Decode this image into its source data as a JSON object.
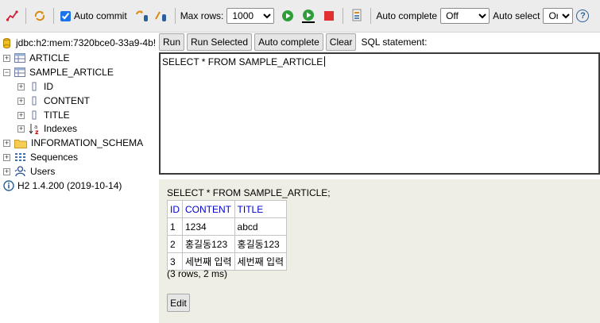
{
  "toolbar": {
    "auto_commit_label": "Auto commit",
    "auto_commit_checked": true,
    "max_rows_label": "Max rows:",
    "max_rows_value": "1000",
    "auto_complete_label": "Auto complete",
    "auto_complete_value": "Off",
    "auto_select_label": "Auto select",
    "auto_select_value": "On",
    "help_glyph": "?"
  },
  "tree": {
    "connection": "jdbc:h2:mem:7320bce0-33a9-4b!",
    "items": [
      {
        "label": "ARTICLE"
      },
      {
        "label": "SAMPLE_ARTICLE"
      },
      {
        "label": "ID"
      },
      {
        "label": "CONTENT"
      },
      {
        "label": "TITLE"
      },
      {
        "label": "Indexes"
      },
      {
        "label": "INFORMATION_SCHEMA"
      },
      {
        "label": "Sequences"
      },
      {
        "label": "Users"
      },
      {
        "label": "H2 1.4.200 (2019-10-14)"
      }
    ]
  },
  "buttons": {
    "run": "Run",
    "run_selected": "Run Selected",
    "auto_complete": "Auto complete",
    "clear": "Clear",
    "sql_label": "SQL statement:"
  },
  "editor": {
    "text": "SELECT * FROM SAMPLE_ARTICLE"
  },
  "result": {
    "sql": "SELECT * FROM SAMPLE_ARTICLE;",
    "columns": [
      "ID",
      "CONTENT",
      "TITLE"
    ],
    "rows": [
      [
        "1",
        "1234",
        "abcd"
      ],
      [
        "2",
        "홍길동123",
        "홍길동123"
      ],
      [
        "3",
        "세번째 입력",
        "세번째 입력"
      ]
    ],
    "summary": "(3 rows, 2 ms)",
    "edit_label": "Edit"
  },
  "colors": {
    "toolbar_bg": "#ececec",
    "result_bg": "#efeee4",
    "header_link": "#0000cc",
    "stop_red": "#e03030",
    "run_green": "#2e9e3a"
  }
}
